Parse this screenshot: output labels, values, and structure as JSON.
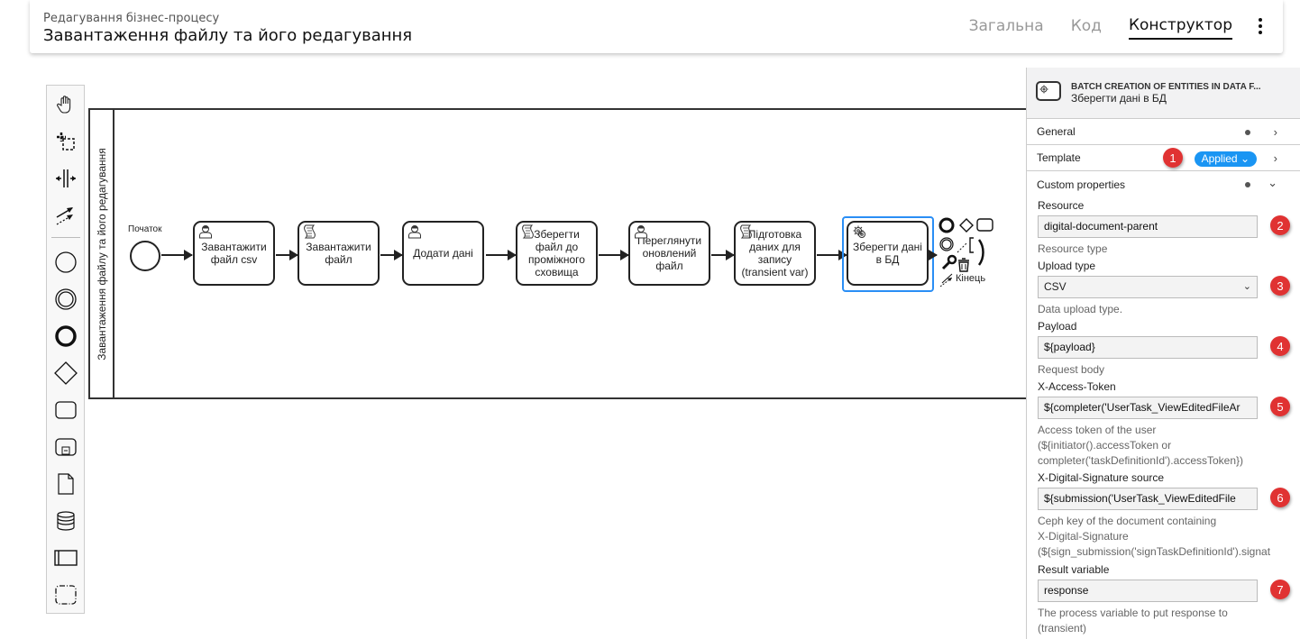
{
  "header": {
    "subtitle": "Редагування бізнес-процесу",
    "title": "Завантаження файлу та його редагування",
    "tabs": [
      {
        "label": "Загальна",
        "active": false
      },
      {
        "label": "Код",
        "active": false
      },
      {
        "label": "Конструктор",
        "active": true
      }
    ],
    "more_icon": "kebab-vertical-icon"
  },
  "palette": {
    "tools": [
      "hand-tool-icon",
      "lasso-tool-icon",
      "space-tool-icon",
      "global-connect-icon"
    ],
    "shapes": [
      "start-event-icon",
      "intermediate-event-icon",
      "end-event-icon",
      "gateway-icon",
      "task-icon",
      "subprocess-icon",
      "data-object-icon",
      "data-store-icon",
      "pool-icon",
      "group-icon"
    ]
  },
  "diagram": {
    "pool_label": "Завантаження файлу та його редагування",
    "start_event_label": "Початок",
    "end_event_label": "Кінець",
    "tasks": [
      {
        "label": "Завантажити файл csv",
        "type": "user-task-icon"
      },
      {
        "label": "Завантажити файл",
        "type": "script-task-icon"
      },
      {
        "label": "Додати дані",
        "type": "user-task-icon"
      },
      {
        "label": "Зберегти файл до проміжного сховища",
        "type": "script-task-icon"
      },
      {
        "label": "Переглянути оновлений файл",
        "type": "user-task-icon"
      },
      {
        "label": "Підготовка даних для запису (transient var)",
        "type": "script-task-icon"
      },
      {
        "label": "Зберегти дані в БД",
        "type": "service-task-icon",
        "selected": true
      }
    ]
  },
  "properties": {
    "element_type": "BATCH CREATION OF ENTITIES IN DATA F...",
    "element_name": "Зберегти дані в БД",
    "groups": [
      {
        "label": "General",
        "has_dot": true,
        "expanded": false
      },
      {
        "label": "Template",
        "status": "Applied",
        "badge": "1",
        "expanded": false
      },
      {
        "label": "Custom properties",
        "has_dot": true,
        "expanded": true
      }
    ],
    "fields": [
      {
        "label": "Resource",
        "value": "digital-document-parent",
        "desc": [
          "Resource type"
        ],
        "badge": "2",
        "kind": "input"
      },
      {
        "label": "Upload type",
        "value": "CSV",
        "desc": [
          "Data upload type."
        ],
        "badge": "3",
        "kind": "select"
      },
      {
        "label": "Payload",
        "value": "${payload}",
        "desc": [
          "Request body"
        ],
        "badge": "4",
        "kind": "input"
      },
      {
        "label": "X-Access-Token",
        "value": "${completer('UserTask_ViewEditedFileAr",
        "desc": [
          "Access token of the user",
          "(${initiator().accessToken or",
          "completer('taskDefinitionId').accessToken})"
        ],
        "badge": "5",
        "kind": "input"
      },
      {
        "label": "X-Digital-Signature source",
        "value": "${submission('UserTask_ViewEditedFile",
        "desc": [
          "Ceph key of the document containing",
          "X-Digital-Signature",
          "(${sign_submission('signTaskDefinitionId').signat"
        ],
        "badge": "6",
        "kind": "input"
      },
      {
        "label": "Result variable",
        "value": "response",
        "desc": [
          "The process variable to put response to",
          "(transient)"
        ],
        "badge": "7",
        "kind": "input"
      }
    ]
  },
  "colors": {
    "accent": "#1a95f3",
    "selection": "#2a8ef5",
    "badge": "#e03232"
  }
}
